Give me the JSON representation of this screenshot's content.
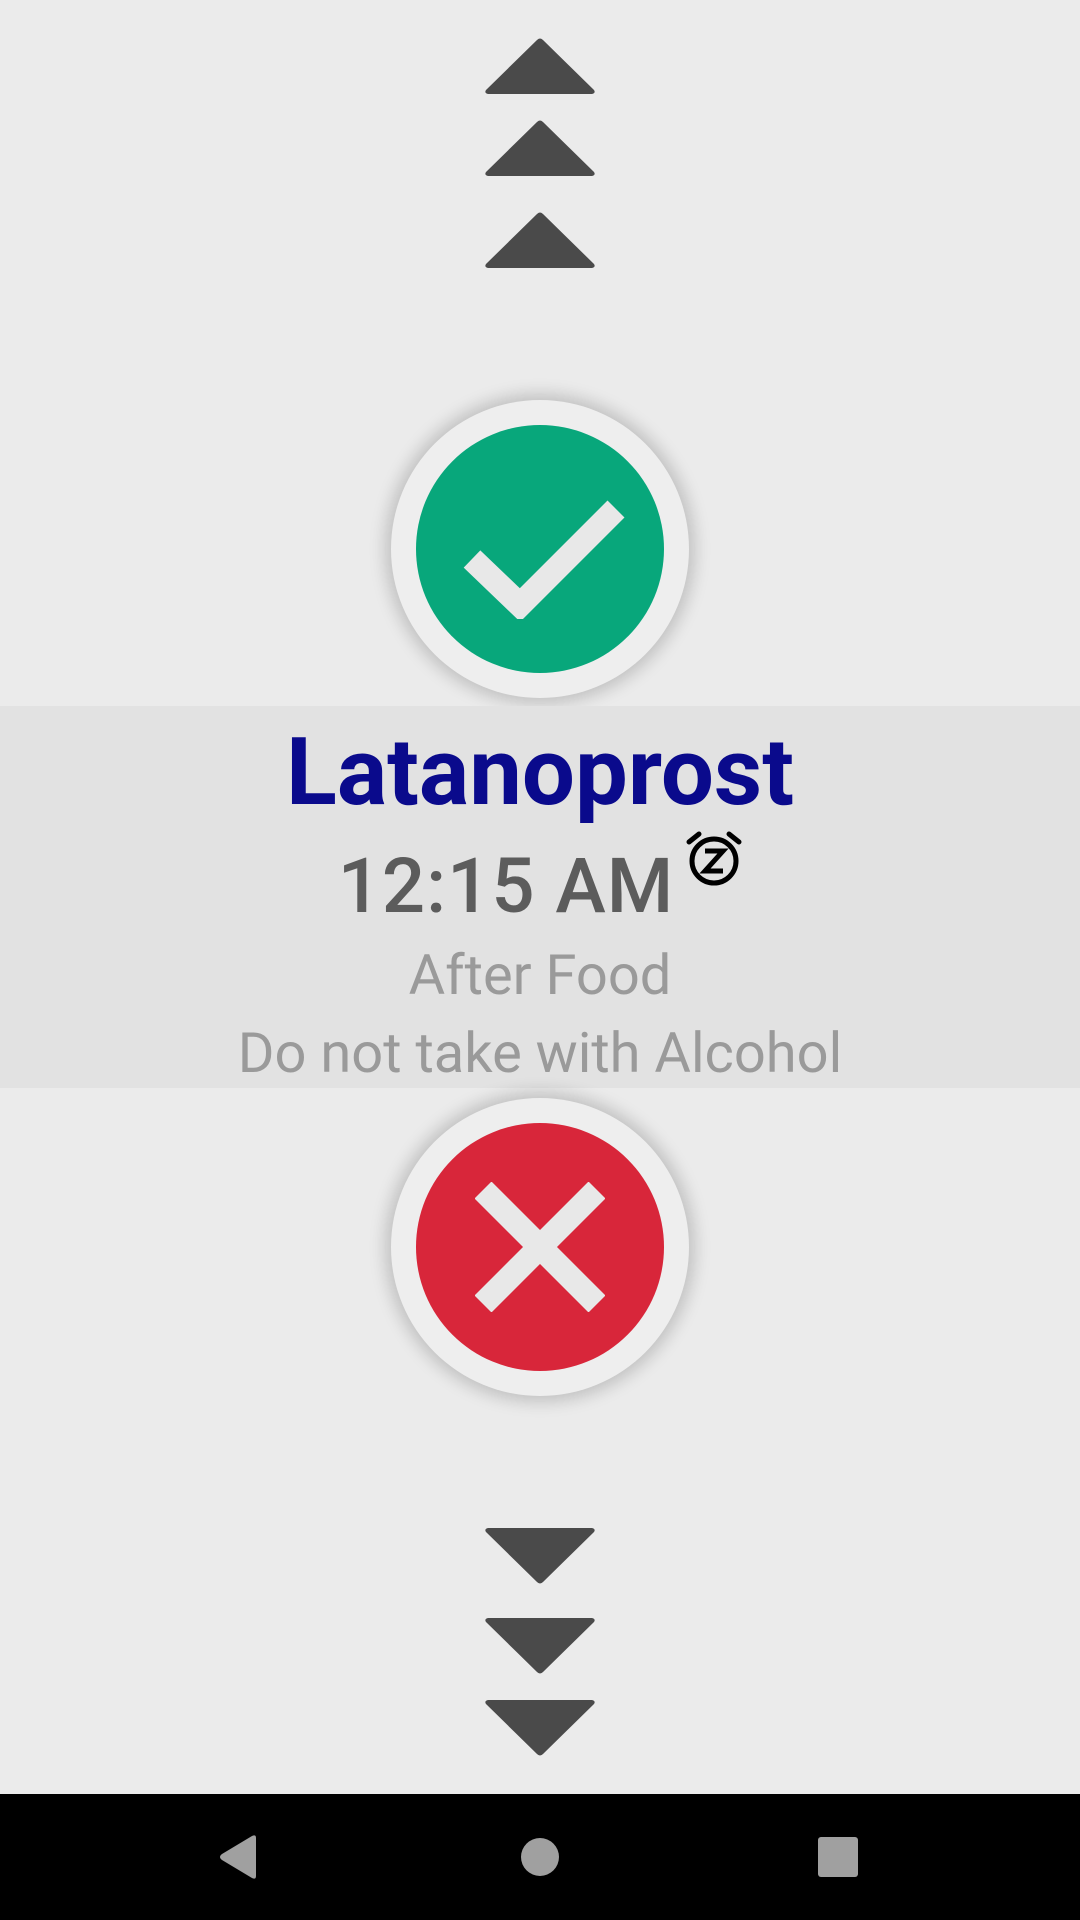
{
  "medication": {
    "name": "Latanoprost",
    "time": "12:15 AM",
    "instructions": [
      "After Food",
      "Do not take with Alcohol"
    ]
  },
  "colors": {
    "take": "#08a77b",
    "skip": "#d8263a",
    "name": "#0a0a8c",
    "chevron": "#4a4a4a"
  },
  "icons": {
    "up": "chevron-up-icon",
    "down": "chevron-down-icon",
    "take": "checkmark-icon",
    "skip": "close-icon",
    "snooze": "snooze-alarm-icon",
    "nav_back": "back-triangle-icon",
    "nav_home": "home-circle-icon",
    "nav_recents": "recents-square-icon"
  }
}
